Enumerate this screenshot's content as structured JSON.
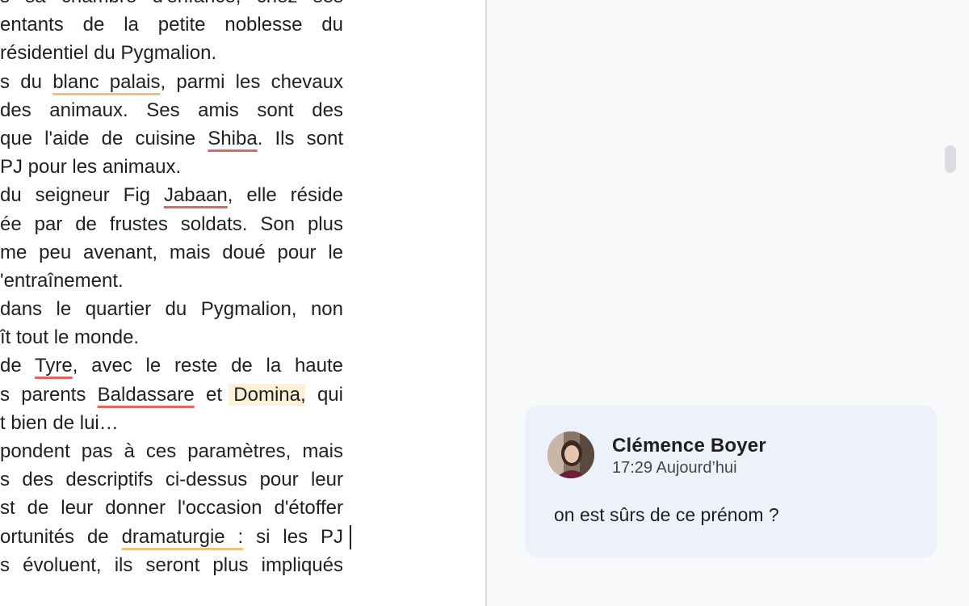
{
  "document": {
    "lines": [
      {
        "parts": [
          {
            "t": "s sa chambre d'enfance, chez ses"
          }
        ]
      },
      {
        "parts": [
          {
            "t": "entants de la petite noblesse du"
          }
        ]
      },
      {
        "parts": [
          {
            "t": "résidentiel du Pygmalion."
          }
        ],
        "last": true
      },
      {
        "parts": [
          {
            "t": "s du "
          },
          {
            "t": "blanc palais",
            "mark": "orange"
          },
          {
            "t": ", parmi les chevaux"
          }
        ]
      },
      {
        "parts": [
          {
            "t": " des animaux. Ses amis sont des"
          }
        ]
      },
      {
        "parts": [
          {
            "t": "que l'aide de cuisine "
          },
          {
            "t": "Shiba",
            "mark": "red"
          },
          {
            "t": ". Ils sont"
          }
        ]
      },
      {
        "parts": [
          {
            "t": " PJ pour les animaux."
          }
        ],
        "last": true
      },
      {
        "parts": [
          {
            "t": " du seigneur Fig "
          },
          {
            "t": "Jabaan",
            "mark": "red"
          },
          {
            "t": ", elle réside"
          }
        ]
      },
      {
        "parts": [
          {
            "t": "ée par de frustes soldats. Son plus"
          }
        ]
      },
      {
        "parts": [
          {
            "t": "me peu avenant, mais doué pour le"
          }
        ]
      },
      {
        "parts": [
          {
            "t": "'entraînement."
          }
        ],
        "last": true
      },
      {
        "parts": [
          {
            "t": "dans le quartier du Pygmalion, non"
          }
        ]
      },
      {
        "parts": [
          {
            "t": "ît tout le monde."
          }
        ],
        "last": true
      },
      {
        "parts": [
          {
            "t": " de "
          },
          {
            "t": "Tyre",
            "mark": "red"
          },
          {
            "t": ", avec le reste de la haute"
          }
        ]
      },
      {
        "parts": [
          {
            "t": "s parents "
          },
          {
            "t": "Baldassare",
            "mark": "red"
          },
          {
            "t": " et "
          },
          {
            "t": "Domina",
            "mark": "highlight"
          },
          {
            "t": ", qui"
          }
        ]
      },
      {
        "parts": [
          {
            "t": "t bien de lui…"
          }
        ],
        "last": true
      },
      {
        "parts": [
          {
            "t": "pondent pas à ces paramètres, mais"
          }
        ]
      },
      {
        "parts": [
          {
            "t": "s des descriptifs ci-dessus pour leur"
          }
        ]
      },
      {
        "parts": [
          {
            "t": "st de leur donner l'occasion d'étoffer"
          }
        ]
      },
      {
        "parts": [
          {
            "t": "ortunités de "
          },
          {
            "t": "dramaturgie :",
            "mark": "orange"
          },
          {
            "t": " si les PJ"
          }
        ]
      },
      {
        "parts": [
          {
            "t": "s évoluent, ils seront plus impliqués"
          }
        ]
      }
    ]
  },
  "comment": {
    "author": "Clémence Boyer",
    "timestamp": "17:29 Aujourd’hui",
    "text": "on est sûrs de ce prénom ?"
  },
  "colors": {
    "spell_underline": "#e06666",
    "grammar_underline": "#f1c27d",
    "comment_highlight": "#fdf0d5",
    "comment_card": "#edf2fa"
  }
}
